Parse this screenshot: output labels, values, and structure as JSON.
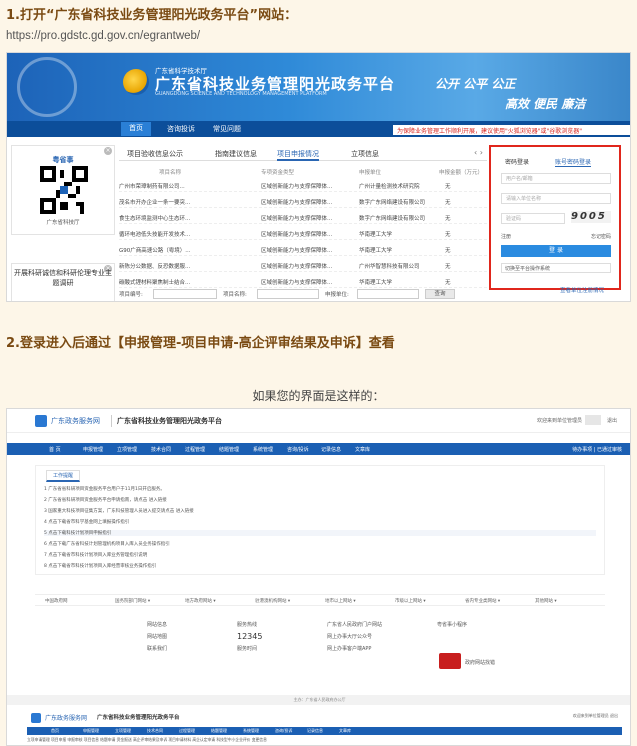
{
  "step1": {
    "title": "1.打开“广东省科技业务管理阳光政务平台”网站：",
    "url": "https://pro.gdstc.gd.gov.cn/egrantweb/"
  },
  "step2": {
    "title": "2.登录进入后通过【申报管理-项目申请-高企评审结果及申诉】查看"
  },
  "caption": "如果您的界面是这样的：",
  "shot1": {
    "header": {
      "subtitle": "广东省科学技术厅",
      "title": "广东省科技业务管理阳光政务平台",
      "en": "GUANGDONG SCIENCE AND TECHNOLOGY MANAGEMENT PLATFORM",
      "slogan1": "公开 公平 公正",
      "slogan2": "高效 便民 廉洁"
    },
    "nav": [
      "首页",
      "咨询投诉",
      "常见问题"
    ],
    "notice": "为保障业务管理工作顺利开展，建议使用\"火狐浏览器\"或\"谷歌浏览器\"",
    "qr": {
      "title": "粤省事",
      "caption": "广东省科技厅"
    },
    "left_notice": "开展科研诚信和科研伦理专业主题调研",
    "tabs": [
      "项目验收信息公示",
      "指南建议信息",
      "项目申报情况",
      "立项信息"
    ],
    "tab_arrows": "‹  ›",
    "table_head": [
      "项目名称",
      "专项资金类型",
      "申报单位",
      "申报金额（万元）"
    ],
    "rows": [
      [
        "广州市荣璋制药有限公司...",
        "区域创新能力与支撑保障体...",
        "广州计量检测技术研究院",
        "无"
      ],
      [
        "茂名市开办企业一条一要突...",
        "区域创新能力与支撑保障体...",
        "数字广东网络建设有限公司",
        "无"
      ],
      [
        "食生态环境监测中心生态环...",
        "区域创新能力与支撑保障体...",
        "数字广东网络建设有限公司",
        "无"
      ],
      [
        "循环电池低头技能开发技术...",
        "区域创新能力与支撑保障体...",
        "华南理工大学",
        "无"
      ],
      [
        "G90广商高速公路（粤境）...",
        "区域创新能力与支撑保障体...",
        "华南理工大学",
        "无"
      ],
      [
        "新陈分公数据、反恐数据服...",
        "区域创新能力与支撑保障体...",
        "广州华智慧科技有限公司",
        "无"
      ],
      [
        "碳酸式锂材料聚焦制士结合...",
        "区域创新能力与支撑保障体...",
        "华南理工大学",
        "无"
      ]
    ],
    "search": {
      "code_label": "项目编号:",
      "name_label": "项目名称:",
      "unit_label": "申报单位:",
      "button": "查询"
    },
    "login": {
      "tabs": [
        "密码登录",
        "账号密码登录"
      ],
      "username": "用户名/邮箱",
      "unit": "请输入单位名称",
      "code": "验证码",
      "captcha": "9005",
      "register": "注册",
      "forgot": "忘记密码",
      "button": "登 录",
      "select": "切换至平台操作系统",
      "query_link": "查看单位注册情况"
    }
  },
  "shot2": {
    "brand": "广东政务服务网",
    "title": "广东省科技业务管理阳光政务平台",
    "welcome": "欢迎来到单位管理员",
    "logout": "退出",
    "nav": [
      "首 页",
      "申报管理",
      "立项管理",
      "技术合同",
      "过程管理",
      "结题管理",
      "系统管理",
      "咨询/投诉",
      "记录信息",
      "文章库"
    ],
    "nav_right": "待办事项 | 已通过审核",
    "panel_tab": "工作提醒",
    "lines": [
      "1  广东省省科研项目资金服务平台用户于11月1日开启服务。",
      "2  广东省省科研项目资金服务平台申请指南，请点击 进入链接",
      "3  国家重大科技项目征集方案，广东科技管理人员进入提交请点击 进入链接",
      "4  点击下载省市科学基金网上填报操作指引",
      "5  点击下载科技计划项目申报指引",
      "6  点击下载广东省科技计划管理机构项目入库入员业务操作指引",
      "7  点击下载省市科技计划项目入库业务管理指引说明",
      "8  点击下载省市科技计划项目入库经营审核业务操作指引"
    ],
    "links": [
      "中国政府网",
      "国务院部门网站 ▾",
      "地方政府网站 ▾",
      "驻港澳机构网站 ▾",
      "地市以上网站 ▾",
      "市级以上网站 ▾",
      "省内专业类网站 ▾",
      "其他网站 ▾"
    ],
    "footer": {
      "col1": [
        "网站信息",
        "网站地图",
        "联系我们"
      ],
      "col2_label": "服务热线",
      "col2_value": "12345",
      "col2_sub": "服务时间",
      "col3": [
        "广东省人民政府门户网站",
        "网上办事大厅公众号",
        "网上办事客户端APP"
      ],
      "col4": "粤省事小程序",
      "badge": "政府网站找错"
    },
    "copyright": "主办：广东省人民政府办公厅",
    "bottom": {
      "brand": "广东政务服务网",
      "title": "广东省科技业务管理阳光政务平台",
      "right": "欢迎来到单位管理员  退出",
      "nav": [
        "首页",
        "申报管理",
        "立项管理",
        "技术合同",
        "过程管理",
        "结题管理",
        "系统管理",
        "咨询/投诉",
        "记录信息",
        "文章库"
      ],
      "sub": "立项申请管理  项目申报  申报审核  项目信息  结题申请  资金报送  高企评审结果及申诉  项目申请材料  高企认定申请  科技型中小企业评价  变更信息"
    }
  },
  "colors": {
    "accent": "#2a66b3",
    "highlight_border": "#e0261c",
    "nav": "#0c4e9a",
    "step_title": "#7a4a12"
  }
}
